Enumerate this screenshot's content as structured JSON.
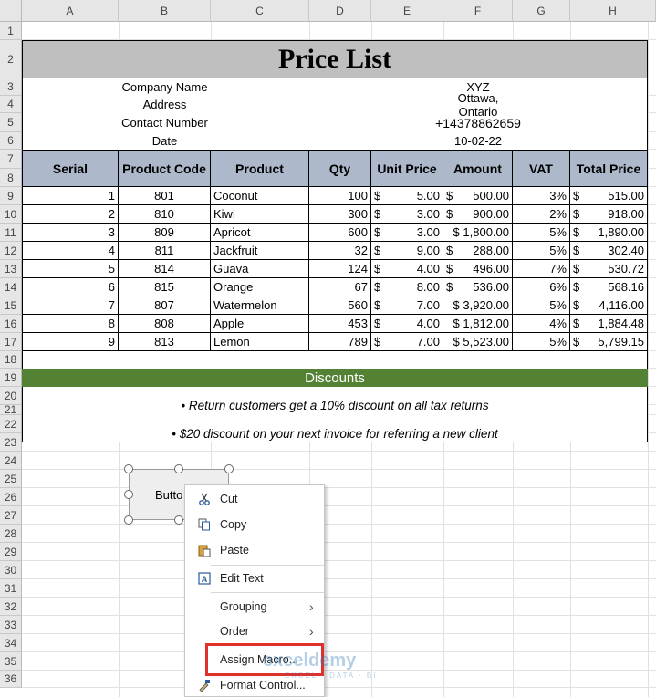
{
  "columns": [
    "A",
    "B",
    "C",
    "D",
    "E",
    "F",
    "G",
    "H"
  ],
  "rows": [
    "1",
    "2",
    "3",
    "4",
    "5",
    "6",
    "7",
    "8",
    "9",
    "10",
    "11",
    "12",
    "13",
    "14",
    "15",
    "16",
    "17",
    "18",
    "19",
    "20",
    "21",
    "22",
    "23",
    "24",
    "25",
    "26",
    "27",
    "28",
    "29",
    "30",
    "31",
    "32",
    "33",
    "34",
    "35",
    "36"
  ],
  "title": "Price List",
  "info": [
    {
      "label": "Company Name",
      "value": "XYZ"
    },
    {
      "label": "Address",
      "value": "Ottawa, Ontario"
    },
    {
      "label": "Contact Number",
      "value": "+14378862659"
    },
    {
      "label": "Date",
      "value": "10-02-22"
    }
  ],
  "table_headers": [
    "Serial",
    "Product Code",
    "Product",
    "Qty",
    "Unit Price",
    "Amount",
    "VAT",
    "Total Price"
  ],
  "table_rows": [
    [
      "1",
      "801",
      "Coconut",
      "100",
      "$",
      "5.00",
      "$",
      "500.00",
      "3%",
      "$",
      "515.00"
    ],
    [
      "2",
      "810",
      "Kiwi",
      "300",
      "$",
      "3.00",
      "$",
      "900.00",
      "2%",
      "$",
      "918.00"
    ],
    [
      "3",
      "809",
      "Apricot",
      "600",
      "$",
      "3.00",
      "$ 1,800.00",
      "",
      "5%",
      "$",
      "1,890.00"
    ],
    [
      "4",
      "811",
      "Jackfruit",
      "32",
      "$",
      "9.00",
      "$",
      "288.00",
      "5%",
      "$",
      "302.40"
    ],
    [
      "5",
      "814",
      "Guava",
      "124",
      "$",
      "4.00",
      "$",
      "496.00",
      "7%",
      "$",
      "530.72"
    ],
    [
      "6",
      "815",
      "Orange",
      "67",
      "$",
      "8.00",
      "$",
      "536.00",
      "6%",
      "$",
      "568.16"
    ],
    [
      "7",
      "807",
      "Watermelon",
      "560",
      "$",
      "7.00",
      "$ 3,920.00",
      "",
      "5%",
      "$",
      "4,116.00"
    ],
    [
      "8",
      "808",
      "Apple",
      "453",
      "$",
      "4.00",
      "$ 1,812.00",
      "",
      "4%",
      "$",
      "1,884.48"
    ],
    [
      "9",
      "813",
      "Lemon",
      "789",
      "$",
      "7.00",
      "$ 5,523.00",
      "",
      "5%",
      "$",
      "5,799.15"
    ]
  ],
  "discounts_title": "Discounts",
  "notes": [
    "• Return customers get a 10% discount on all tax returns",
    "• $20 discount on your next invoice for referring a new client"
  ],
  "button_label": "Butto",
  "context_menu": {
    "items": [
      {
        "label": "Cut",
        "icon": "scissors-icon"
      },
      {
        "label": "Copy",
        "icon": "copy-icon"
      },
      {
        "label": "Paste",
        "icon": "paste-icon"
      },
      {
        "label": "Edit Text",
        "icon": "edit-text-icon"
      },
      {
        "label": "Grouping",
        "icon": ""
      },
      {
        "label": "Order",
        "icon": ""
      },
      {
        "label": "Assign Macro...",
        "icon": ""
      },
      {
        "label": "Format Control...",
        "icon": "format-control-icon"
      }
    ]
  },
  "watermark": {
    "brand": "exceldemy",
    "tagline": "EXCEL · DATA · BI"
  },
  "colors": {
    "title_band": "#bfbfbf",
    "header_band": "#adb9ca",
    "discount_band": "#548235",
    "highlight": "#e0302c"
  }
}
